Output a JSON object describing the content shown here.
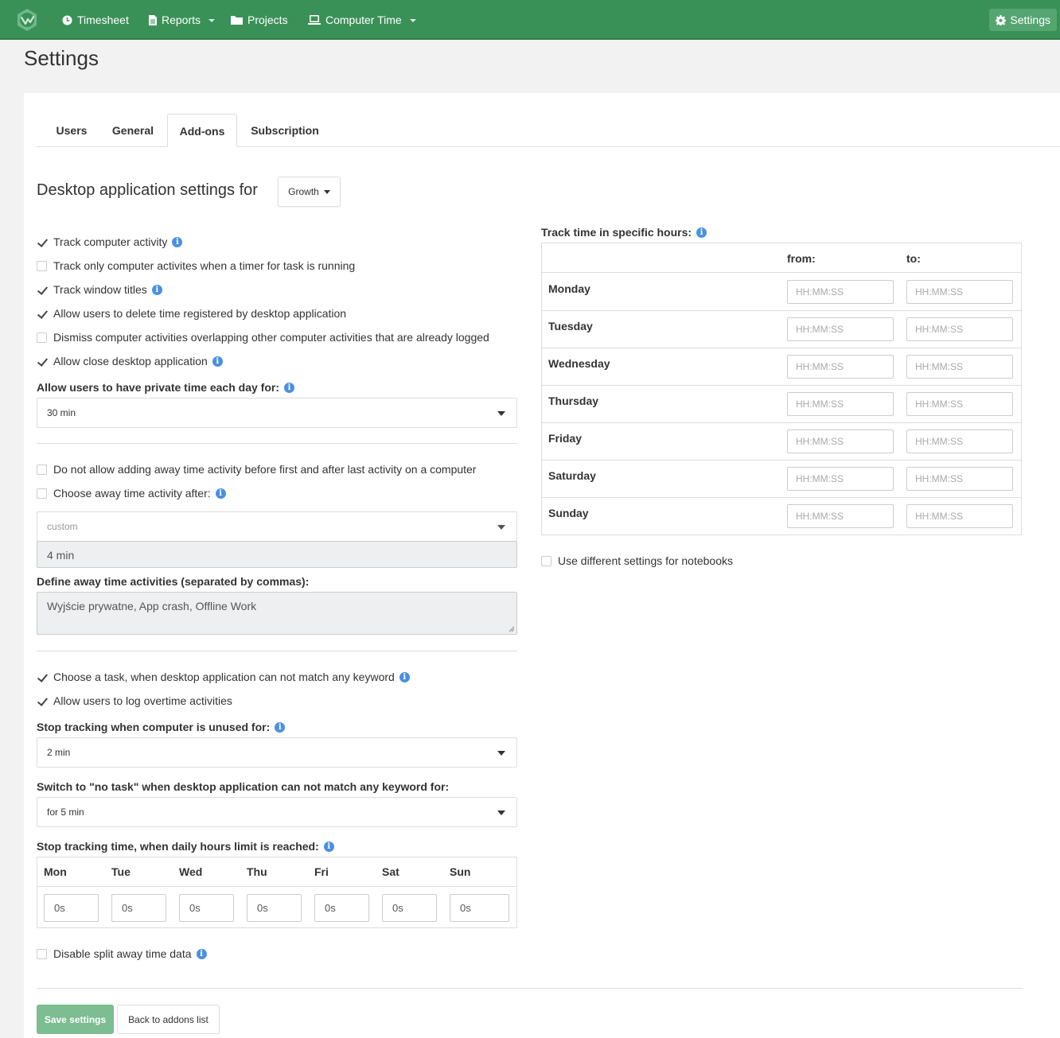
{
  "nav": {
    "items": [
      {
        "label": "Timesheet",
        "icon": "clock-icon"
      },
      {
        "label": "Reports",
        "icon": "document-icon"
      },
      {
        "label": "Projects",
        "icon": "folder-icon"
      },
      {
        "label": "Computer Time",
        "icon": "laptop-icon"
      }
    ],
    "settings_label": "Settings",
    "accent": "#3a9158"
  },
  "page": {
    "title": "Settings"
  },
  "tabs": [
    {
      "label": "Users",
      "active": false
    },
    {
      "label": "General",
      "active": false
    },
    {
      "label": "Add-ons",
      "active": true
    },
    {
      "label": "Subscription",
      "active": false
    }
  ],
  "desktop": {
    "title": "Desktop application settings for",
    "plan_dropdown": "Growth"
  },
  "options": {
    "track_activity": {
      "label": "Track computer activity",
      "checked": true
    },
    "track_only_timer": {
      "label": "Track only computer activites when a timer for task is running",
      "checked": false
    },
    "track_window_titles": {
      "label": "Track window titles",
      "checked": true
    },
    "allow_delete": {
      "label": "Allow users to delete time registered by desktop application",
      "checked": true
    },
    "dismiss_overlap": {
      "label": "Dismiss computer activities overlapping other computer activities that are already logged",
      "checked": false
    },
    "allow_close": {
      "label": "Allow close desktop application",
      "checked": true
    },
    "no_away_adding": {
      "label": "Do not allow adding away time activity before first and after last activity on a computer",
      "checked": false
    },
    "choose_away_after": {
      "label": "Choose away time activity after:",
      "checked": false
    },
    "choose_task": {
      "label": "Choose a task, when desktop application can not match any keyword",
      "checked": true
    },
    "allow_overtime": {
      "label": "Allow users to log overtime activities",
      "checked": true
    },
    "disable_split": {
      "label": "Disable split away time data",
      "checked": false
    },
    "notebooks": {
      "label": "Use different settings for notebooks",
      "checked": false
    }
  },
  "private_time": {
    "label": "Allow users to have private time each day for:",
    "value": "30 min"
  },
  "away": {
    "select_value": "custom",
    "custom_value": "4 min",
    "define_label": "Define away time activities (separated by commas):",
    "activities": "Wyjście prywatne, App crash, Offline Work"
  },
  "unused": {
    "label": "Stop tracking when computer is unused for:",
    "value": "2 min"
  },
  "no_task": {
    "label": "Switch to \"no task\" when desktop application can not match any keyword for:",
    "value": "for 5 min"
  },
  "daily_limit": {
    "label": "Stop tracking time, when daily hours limit is reached:",
    "days": [
      {
        "name": "Mon",
        "value": "0s"
      },
      {
        "name": "Tue",
        "value": "0s"
      },
      {
        "name": "Wed",
        "value": "0s"
      },
      {
        "name": "Thu",
        "value": "0s"
      },
      {
        "name": "Fri",
        "value": "0s"
      },
      {
        "name": "Sat",
        "value": "0s"
      },
      {
        "name": "Sun",
        "value": "0s"
      }
    ]
  },
  "hours": {
    "title": "Track time in specific hours:",
    "from_label": "from:",
    "to_label": "to:",
    "placeholder": "HH:MM:SS",
    "days": [
      "Monday",
      "Tuesday",
      "Wednesday",
      "Thursday",
      "Friday",
      "Saturday",
      "Sunday"
    ]
  },
  "buttons": {
    "save": "Save settings",
    "back": "Back to addons list"
  }
}
